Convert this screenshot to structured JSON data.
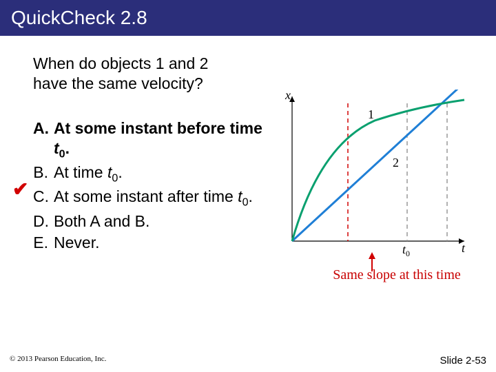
{
  "title": "QuickCheck 2.8",
  "question": "When do objects 1 and 2 have the same velocity?",
  "choices": [
    {
      "letter": "A.",
      "prefix": "At some instant before time ",
      "var": "t",
      "sub": "0",
      "suffix": ".",
      "bold": true,
      "checked": true
    },
    {
      "letter": "B.",
      "prefix": "At time ",
      "var": "t",
      "sub": "0",
      "suffix": ".",
      "bold": false,
      "checked": false
    },
    {
      "letter": "C.",
      "prefix": "At some instant after time ",
      "var": "t",
      "sub": "0",
      "suffix": ".",
      "bold": false,
      "checked": false
    },
    {
      "letter": "D.",
      "prefix": "Both A and B.",
      "var": "",
      "sub": "",
      "suffix": "",
      "bold": false,
      "checked": false
    },
    {
      "letter": "E.",
      "prefix": "Never.",
      "var": "",
      "sub": "",
      "suffix": "",
      "bold": false,
      "checked": false
    }
  ],
  "caption": "Same slope at this time",
  "footer_left": "© 2013 Pearson Education, Inc.",
  "footer_right": "Slide 2-53",
  "chart_data": {
    "type": "line",
    "title": "",
    "xlabel": "t",
    "ylabel": "x",
    "xlim": [
      0,
      10
    ],
    "ylim": [
      0,
      10
    ],
    "series": [
      {
        "name": "1",
        "color": "#0aa06f",
        "x": [
          0,
          1,
          2,
          3,
          4,
          5,
          6,
          7,
          8,
          9,
          10
        ],
        "y": [
          0,
          3.2,
          5.0,
          6.2,
          7.0,
          7.6,
          8.0,
          8.3,
          8.55,
          8.75,
          8.9
        ]
      },
      {
        "name": "2",
        "color": "#1f7fd6",
        "x": [
          0,
          10
        ],
        "y": [
          0,
          9.5
        ]
      }
    ],
    "vlines": [
      {
        "x": 3.4,
        "label": "",
        "color": "#d10000"
      },
      {
        "x": 7.0,
        "label": "t0",
        "color": "#888"
      },
      {
        "x": 9.4,
        "label": "",
        "color": "#888"
      }
    ],
    "intersection_t0": 7.0,
    "labels": [
      {
        "text": "1",
        "x": 4.9,
        "y": 8.2
      },
      {
        "text": "2",
        "x": 6.4,
        "y": 5.1
      }
    ]
  }
}
